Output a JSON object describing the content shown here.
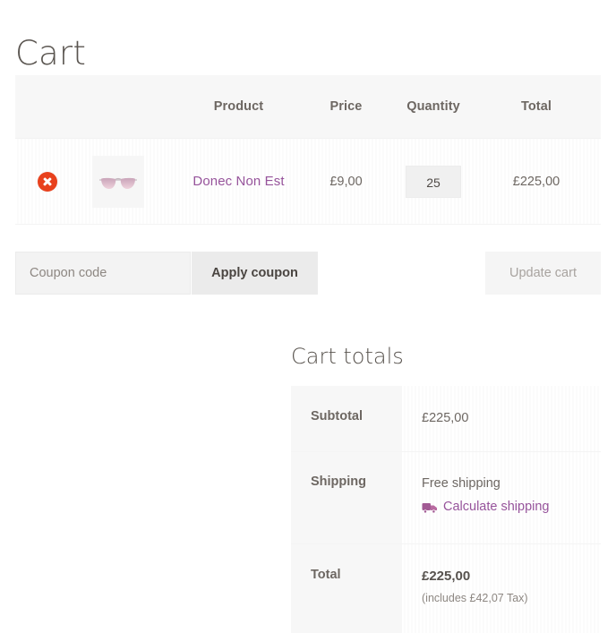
{
  "page": {
    "title": "Cart"
  },
  "cart_table": {
    "headers": {
      "remove": "",
      "thumbnail": "",
      "product": "Product",
      "price": "Price",
      "quantity": "Quantity",
      "total": "Total"
    },
    "rows": [
      {
        "remove_icon": "remove-circle-icon",
        "thumbnail_icon": "sunglasses-thumbnail",
        "product_name": "Donec Non Est",
        "price": "£9,00",
        "quantity": "25",
        "line_total": "£225,00"
      }
    ]
  },
  "actions": {
    "coupon_placeholder": "Coupon code",
    "coupon_value": "",
    "apply_coupon_label": "Apply coupon",
    "update_cart_label": "Update cart"
  },
  "cart_totals": {
    "title": "Cart totals",
    "rows": [
      {
        "label": "Subtotal",
        "value": "£225,00"
      },
      {
        "label": "Shipping",
        "method": "Free shipping",
        "calculate_link": "Calculate shipping",
        "link_icon": "delivery-truck-icon"
      },
      {
        "label": "Total",
        "value": "£225,00",
        "tax_note": "(includes £42,07 Tax)"
      }
    ]
  },
  "colors": {
    "link": "#96539b",
    "remove_button": "#e8411d",
    "text": "#6d6762",
    "header_bg": "#f7f7f7",
    "button_bg": "#ebebeb"
  }
}
